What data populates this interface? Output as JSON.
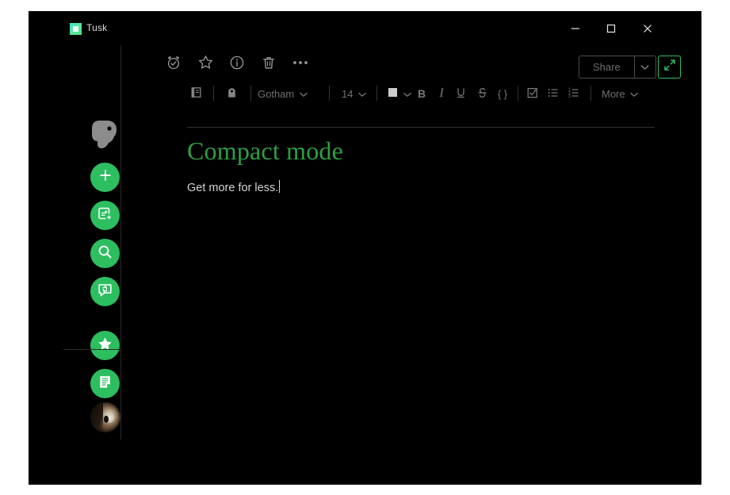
{
  "window": {
    "app_title": "Tusk",
    "app_icon": "tusk-app-icon",
    "controls": {
      "minimize": "minimize-icon",
      "maximize": "maximize-icon",
      "close": "close-icon"
    }
  },
  "sidebar": {
    "logo": "evernote-elephant-logo",
    "items": [
      {
        "name": "new",
        "icon": "plus-icon"
      },
      {
        "name": "new-note",
        "icon": "new-note-icon"
      },
      {
        "name": "search",
        "icon": "search-icon"
      },
      {
        "name": "sync",
        "icon": "sync-share-icon"
      },
      {
        "name": "shortcuts",
        "icon": "star-icon"
      },
      {
        "name": "notes",
        "icon": "notes-document-icon"
      }
    ],
    "avatar": "user-avatar"
  },
  "note_toolbar": {
    "icons": [
      {
        "name": "reminder",
        "icon": "alarm-clock-icon"
      },
      {
        "name": "favorite",
        "icon": "star-outline-icon"
      },
      {
        "name": "info",
        "icon": "info-circle-icon"
      },
      {
        "name": "delete",
        "icon": "trash-icon"
      },
      {
        "name": "more",
        "icon": "ellipsis-icon"
      }
    ],
    "share_label": "Share",
    "share_dropdown_icon": "chevron-down-icon",
    "expand_icon": "expand-arrows-icon"
  },
  "format_toolbar": {
    "notebook_icon": "notebook-icon",
    "tag_icon": "tag-icon",
    "font_family": "Gotham",
    "font_size": "14",
    "chevron": "⌄",
    "color_swatch": "#cccccc",
    "bold_label": "B",
    "italic_label": "I",
    "underline_label": "U",
    "strikethrough_label": "S",
    "code_label": "{ }",
    "todo_icon": "checkbox-list-icon",
    "bullet_icon": "bullet-list-icon",
    "number_icon": "numbered-list-icon",
    "more_label": "More"
  },
  "editor": {
    "title": "Compact mode",
    "body": "Get more for less."
  },
  "colors": {
    "accent_green": "#2dbe60",
    "title_green": "#2f9e44",
    "window_bg": "#000000",
    "page_bg": "#ffffff"
  }
}
